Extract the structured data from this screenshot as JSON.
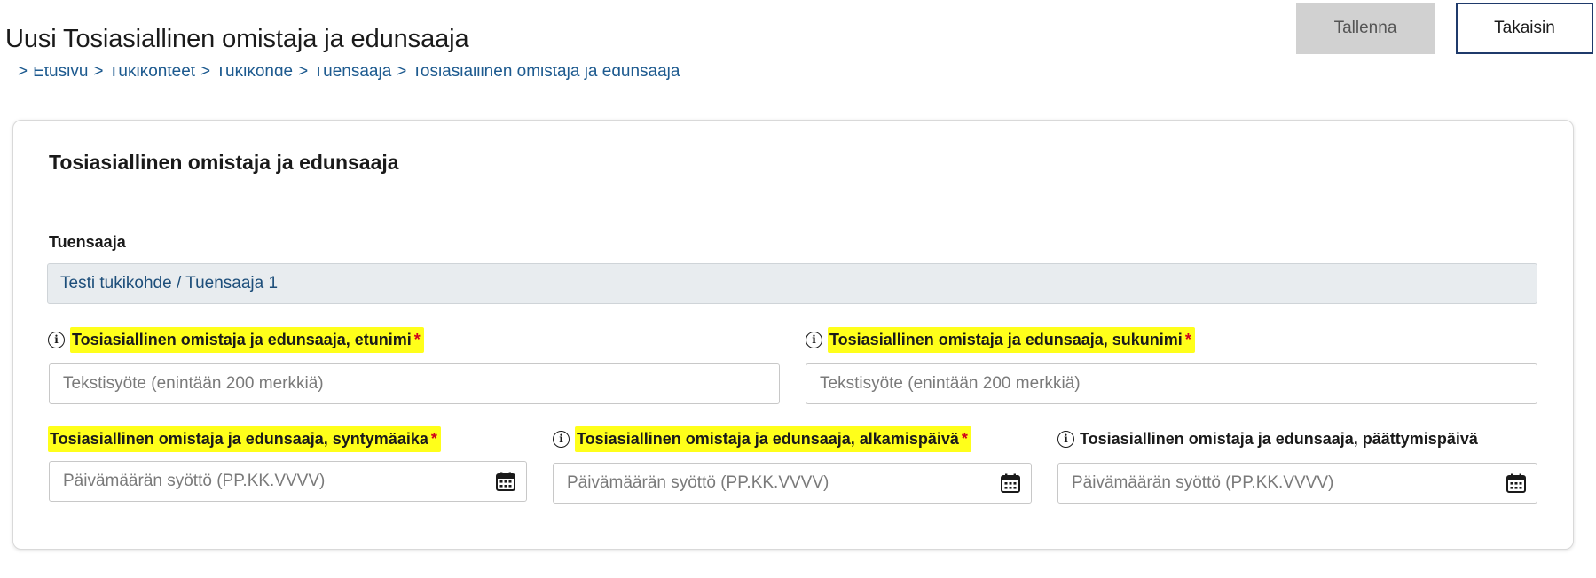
{
  "header": {
    "title": "Uusi Tosiasiallinen omistaja ja edunsaaja",
    "save_label": "Tallenna",
    "back_label": "Takaisin"
  },
  "breadcrumb": {
    "separator": ">",
    "items": [
      "Etusivu",
      "Tukikonteet",
      "Tukikohde",
      "Tuensaaja",
      "Tosiasiallinen omistaja ja edunsaaja"
    ]
  },
  "form": {
    "section_title": "Tosiasiallinen omistaja ja edunsaaja",
    "recipient": {
      "label": "Tuensaaja",
      "value": "Testi tukikohde / Tuensaaja 1"
    },
    "first_name": {
      "label": "Tosiasiallinen omistaja ja edunsaaja, etunimi",
      "required_mark": "*",
      "placeholder": "Tekstisyöte (enintään 200 merkkiä)",
      "value": ""
    },
    "last_name": {
      "label": "Tosiasiallinen omistaja ja edunsaaja, sukunimi",
      "required_mark": "*",
      "placeholder": "Tekstisyöte (enintään 200 merkkiä)",
      "value": ""
    },
    "birth_date": {
      "label": "Tosiasiallinen omistaja ja edunsaaja, syntymäaika",
      "required_mark": "*",
      "placeholder": "Päivämäärän syöttö (PP.KK.VVVV)",
      "value": ""
    },
    "start_date": {
      "label": "Tosiasiallinen omistaja ja edunsaaja, alkamispäivä",
      "required_mark": "*",
      "placeholder": "Päivämäärän syöttö (PP.KK.VVVV)",
      "value": ""
    },
    "end_date": {
      "label": "Tosiasiallinen omistaja ja edunsaaja, päättymispäivä",
      "placeholder": "Päivämäärän syöttö (PP.KK.VVVV)",
      "value": ""
    }
  },
  "icons": {
    "info": "info-icon",
    "calendar": "calendar-icon"
  },
  "colors": {
    "highlight": "#ffff1a",
    "required": "#d0021b",
    "link": "#1d5a8f",
    "primary_border": "#1f3a6b",
    "disabled_button": "#d1d1d1"
  }
}
